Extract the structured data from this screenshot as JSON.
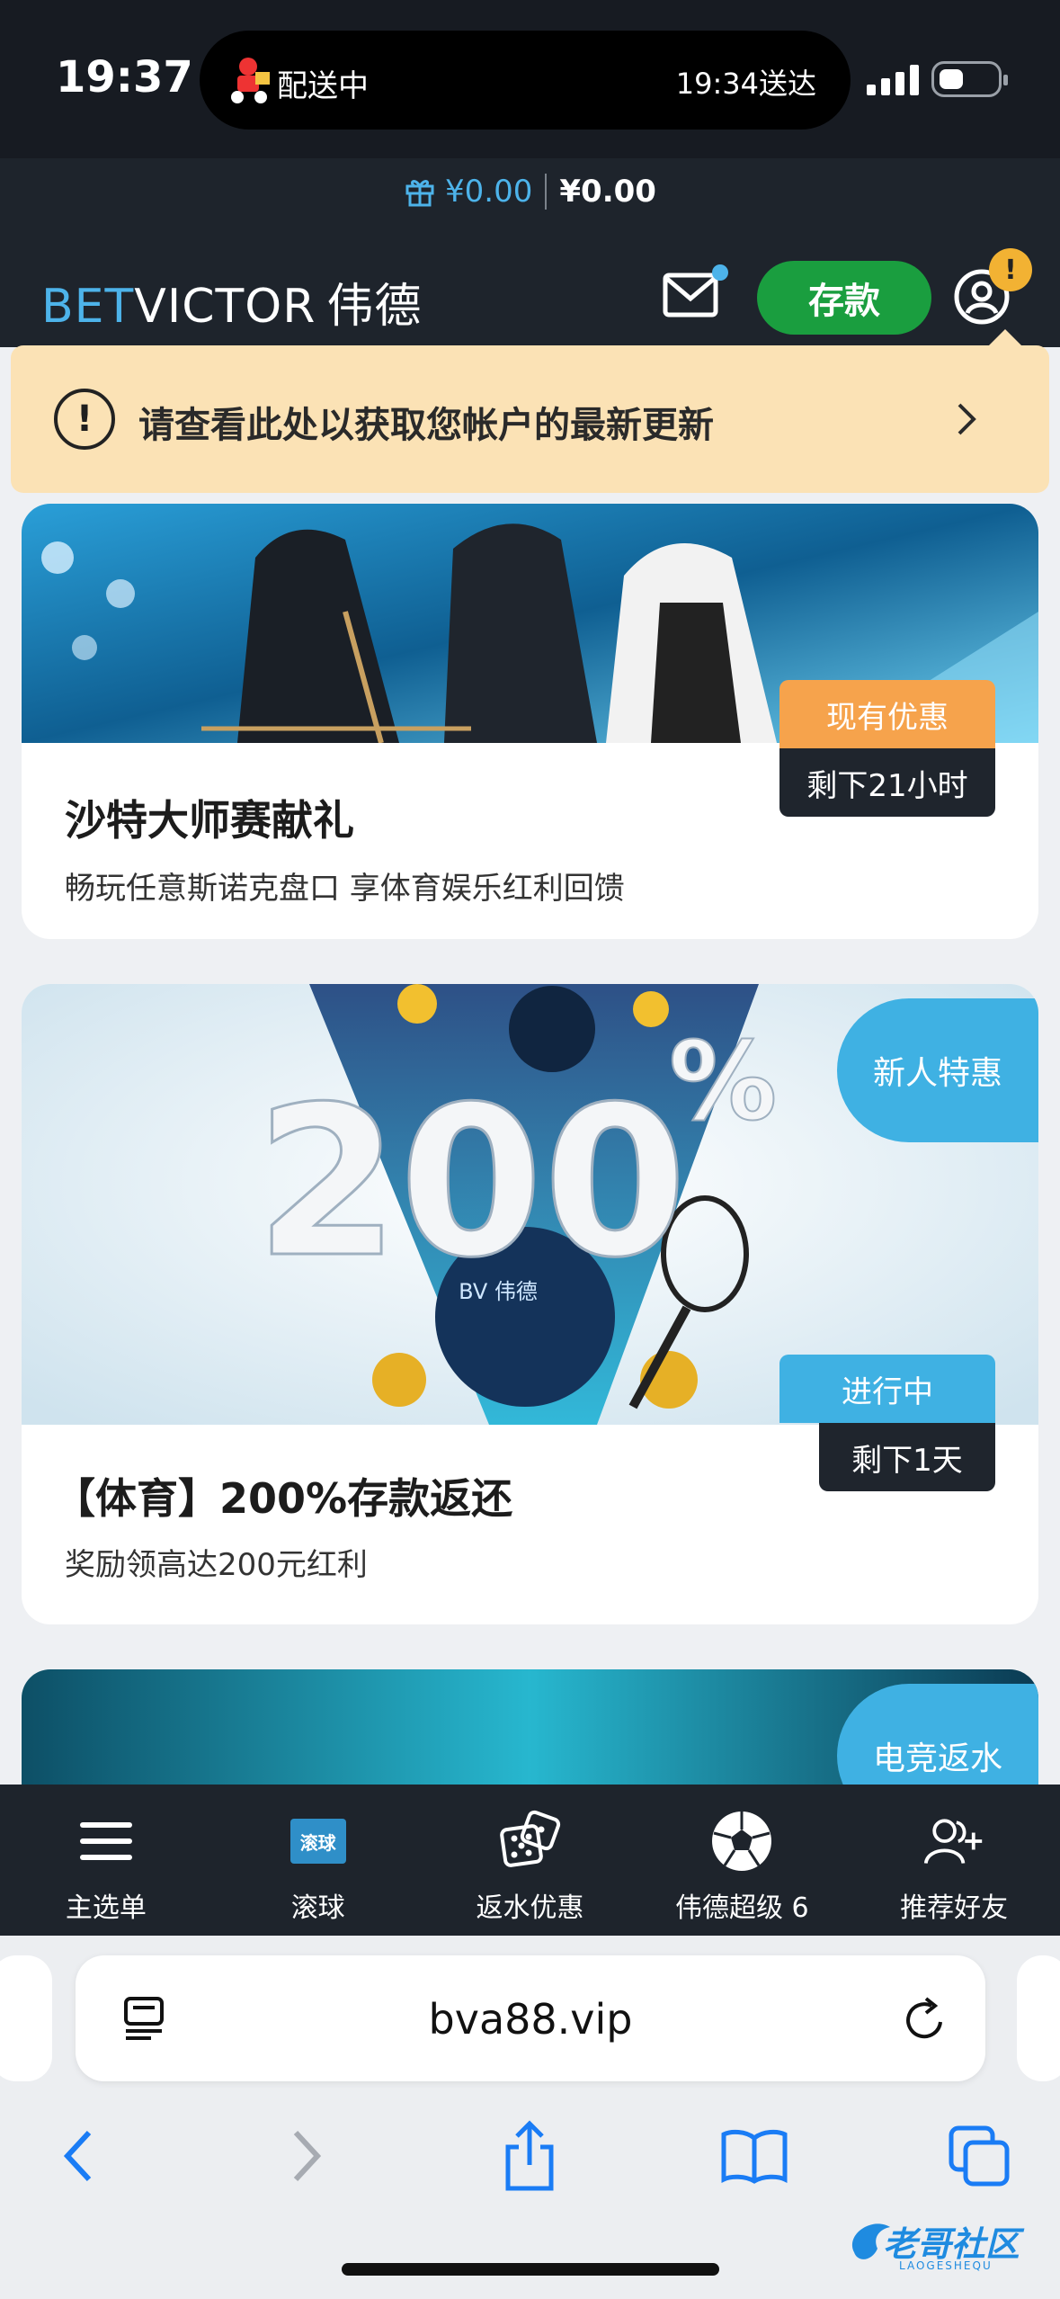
{
  "status_bar": {
    "time": "19:37",
    "activity_label": "配送中",
    "activity_eta": "19:34送达"
  },
  "header": {
    "balance_primary": "¥0.00",
    "balance_secondary": "¥0.00",
    "logo_bet": "BET",
    "logo_victor": "VICTOR",
    "logo_cn": "伟德",
    "deposit_label": "存款",
    "account_badge": "!"
  },
  "notice": {
    "text": "请查看此处以获取您帐户的最新更新"
  },
  "promos": [
    {
      "title": "沙特大师赛献礼",
      "subtitle": "畅玩任意斯诺克盘口 享体育娱乐红利回馈",
      "status": "现有优惠",
      "remaining": "剩下21小时"
    },
    {
      "title": "【体育】200%存款返还",
      "subtitle": "奖励领高达200元红利",
      "status": "进行中",
      "remaining": "剩下1天",
      "badge": "新人特惠",
      "banner_big_text": "200",
      "banner_pct": "%",
      "ball_text": "BV\n伟德"
    },
    {
      "badge": "电竞返水"
    }
  ],
  "bottom_nav": [
    {
      "label": "主选单",
      "icon": "menu-icon"
    },
    {
      "label": "滚球",
      "icon": "live-icon",
      "icon_text": "滚球"
    },
    {
      "label": "返水优惠",
      "icon": "dice-icon"
    },
    {
      "label": "伟德超级 6",
      "icon": "soccer-ball-icon"
    },
    {
      "label": "推荐好友",
      "icon": "add-friend-icon"
    }
  ],
  "browser": {
    "url": "bva88.vip"
  },
  "watermark": {
    "text": "老哥社区",
    "sub": "LAOGESHEQU"
  },
  "colors": {
    "accent_blue": "#4db3ea",
    "deposit_green": "#1a9e3f",
    "notice_bg": "#fbe2b5",
    "tag_orange": "#f6a34c",
    "tag_blue": "#3fb1e3",
    "header_bg": "#1e242c"
  }
}
